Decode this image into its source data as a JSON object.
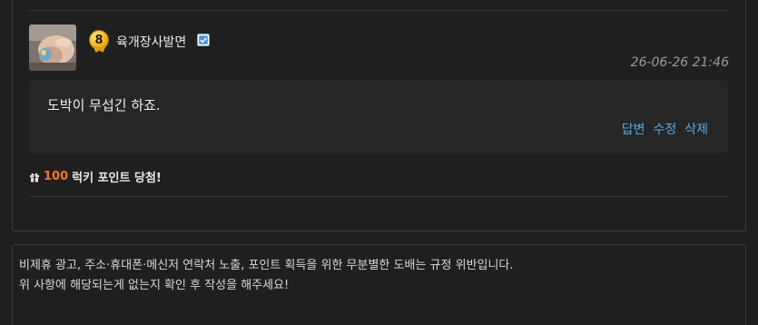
{
  "comment": {
    "author": {
      "level": "8",
      "name": "육개장사발면",
      "verified": true
    },
    "timestamp": "26-06-26 21:46",
    "text": "도박이 무섭긴 하죠.",
    "actions": {
      "reply": "답변",
      "edit": "수정",
      "delete": "삭제"
    },
    "lucky": {
      "points": "100",
      "message": "럭키 포인트 당첨!"
    }
  },
  "notice": {
    "line1": "비제휴 광고, 주소·휴대폰·메신저 연락처 노출, 포인트 획득을 위한 무분별한 도배는 규정 위반입니다.",
    "line2": "위 사항에 해당되는게 없는지 확인 후 작성을 해주세요!"
  },
  "colors": {
    "link": "#5aa6e0",
    "points": "#f0772a",
    "verified": "#4a90d9"
  }
}
